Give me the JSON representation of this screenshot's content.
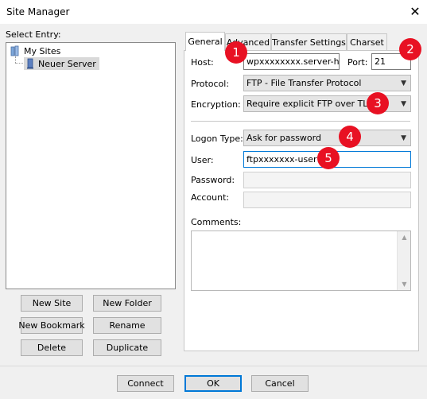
{
  "window": {
    "title": "Site Manager",
    "close_glyph": "✕"
  },
  "left": {
    "select_entry_label": "Select Entry:",
    "tree": [
      {
        "label": "My Sites",
        "icon": "folder-icon"
      },
      {
        "label": "Neuer Server",
        "icon": "server-icon"
      }
    ],
    "buttons": {
      "new_site": "New Site",
      "new_folder": "New Folder",
      "new_bookmark": "New Bookmark",
      "rename": "Rename",
      "delete": "Delete",
      "duplicate": "Duplicate"
    }
  },
  "tabs": [
    "General",
    "Advanced",
    "Transfer Settings",
    "Charset"
  ],
  "general": {
    "host_label": "Host:",
    "host_value": "wpxxxxxxxx.server-he.c",
    "port_label": "Port:",
    "port_value": "21",
    "protocol_label": "Protocol:",
    "protocol_value": "FTP - File Transfer Protocol",
    "encryption_label": "Encryption:",
    "encryption_value": "Require explicit FTP over TLS",
    "logon_type_label": "Logon Type:",
    "logon_type_value": "Ask for password",
    "user_label": "User:",
    "user_value": "ftpxxxxxxx-user1",
    "password_label": "Password:",
    "account_label": "Account:",
    "comments_label": "Comments:"
  },
  "badges": [
    "1",
    "2",
    "3",
    "4",
    "5"
  ],
  "footer": {
    "connect": "Connect",
    "ok": "OK",
    "cancel": "Cancel"
  },
  "colors": {
    "badge": "#e81123",
    "focus": "#0078d7",
    "selected_item": "#d9d9d9"
  }
}
